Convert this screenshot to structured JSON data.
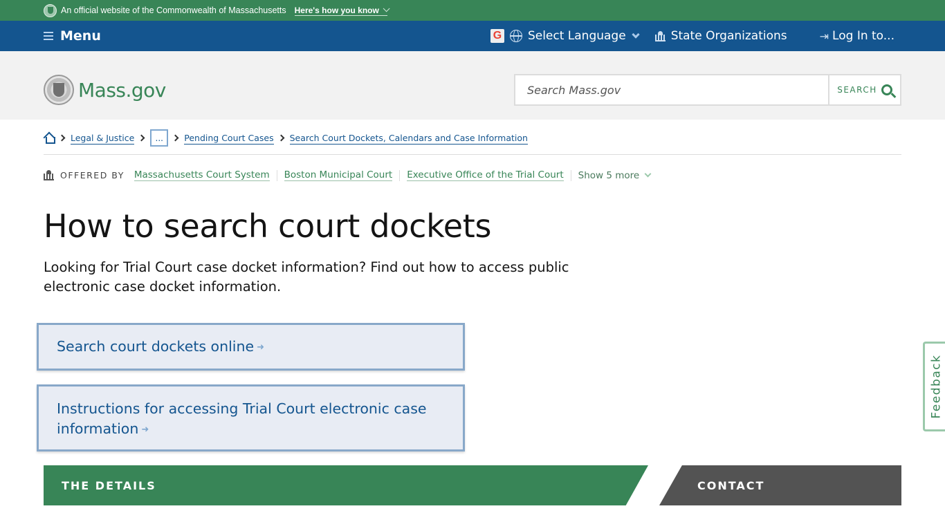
{
  "official_banner": {
    "text": "An official website of the Commonwealth of Massachusetts",
    "how_label": "Here's how you know"
  },
  "utility_nav": {
    "menu_label": "Menu",
    "translate_icon": "google-translate-icon",
    "language_label": "Select Language",
    "state_orgs_label": "State Organizations",
    "login_label": "Log In to..."
  },
  "header": {
    "logo_text": "Mass.gov",
    "search_placeholder": "Search Mass.gov",
    "search_button_label": "SEARCH"
  },
  "breadcrumb": {
    "items": [
      "Legal & Justice",
      "...",
      "Pending Court Cases",
      "Search Court Dockets, Calendars and Case Information"
    ]
  },
  "offered_by": {
    "label": "OFFERED BY",
    "orgs": [
      "Massachusetts Court System",
      "Boston Municipal Court",
      "Executive Office of the Trial Court"
    ],
    "show_more_label": "Show 5 more"
  },
  "page": {
    "title": "How to search court dockets",
    "lede": "Looking for Trial Court case docket information? Find out how to access public electronic case docket information."
  },
  "links": [
    {
      "label": "Search court dockets online"
    },
    {
      "label": "Instructions for accessing Trial Court electronic case information"
    }
  ],
  "sections": {
    "details_label": "THE DETAILS",
    "contact_label": "CONTACT"
  },
  "feedback_label": "Feedback",
  "colors": {
    "green": "#388557",
    "blue": "#14558f",
    "gray_bar": "#535353",
    "header_bg": "#f2f2f2",
    "card_bg": "#e8ecf4"
  }
}
